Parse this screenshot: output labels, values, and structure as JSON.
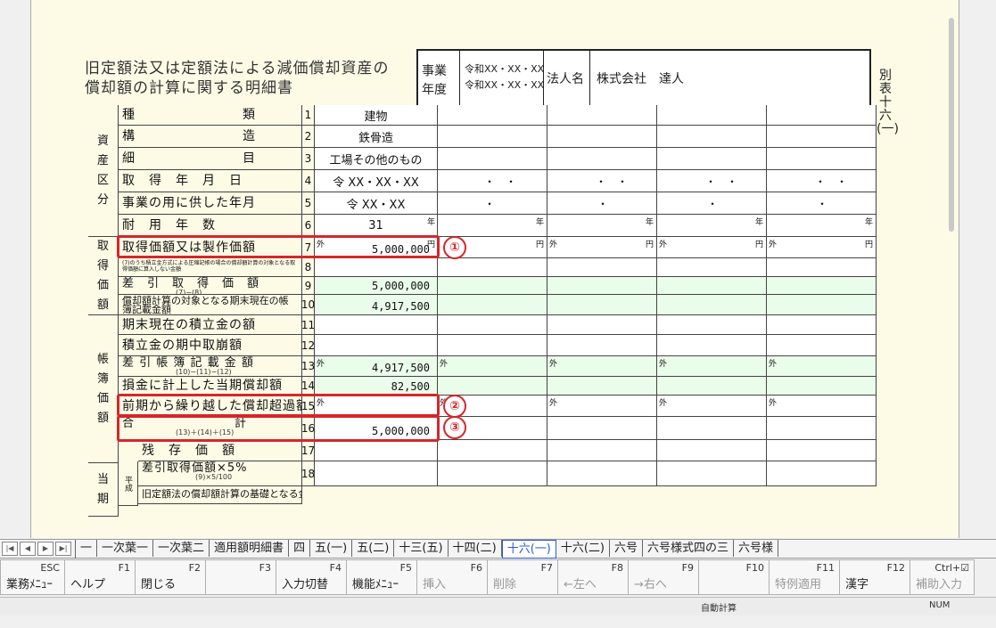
{
  "title": {
    "line1": "旧定額法又は定額法による減価償却資産の",
    "line2": "償却額の計算に関する明細書"
  },
  "header": {
    "jigyou": "事業",
    "nendo": "年度",
    "period_from": "令和XX・XX・XX",
    "period_to": "令和XX・XX・XX",
    "hojin_label": "法人名",
    "hojin_name": "株式会社　達人"
  },
  "side_note": "別表十六(一)",
  "sections": {
    "shisan": "資\n産\n区\n分",
    "shutoku": "取\n得\n価\n額",
    "chobo": "帳\n簿\n価\n額",
    "touki": "当\n期"
  },
  "rows": [
    {
      "no": "1",
      "label": "種　　　　　　　　類",
      "value": "建物"
    },
    {
      "no": "2",
      "label": "構　　　　　　　　造",
      "value": "鉄骨造"
    },
    {
      "no": "3",
      "label": "細　　　　　　　　目",
      "value": "工場その他のもの"
    },
    {
      "no": "4",
      "label": "取　得　年　月　日",
      "value": "令 XX・XX・XX"
    },
    {
      "no": "5",
      "label": "事業の用に供した年月",
      "value": "令 XX・XX"
    },
    {
      "no": "6",
      "label": "耐　用　年　数",
      "value": "31",
      "unit": "年"
    },
    {
      "no": "7",
      "label": "取得価額又は製作価額",
      "value": "5,000,000",
      "prefix": "外",
      "unit": "円"
    },
    {
      "no": "8",
      "label": "(7)のうち積立金方式による圧縮記帳の場合の償却額計算の対象となる取得価額に算入しない金額",
      "value": ""
    },
    {
      "no": "9",
      "label": "差　引　取　得　価　額",
      "sub": "(7)−(8)",
      "value": "5,000,000"
    },
    {
      "no": "10",
      "label": "償却額計算の対象となる期末現在の帳簿記載金額",
      "value": "4,917,500"
    },
    {
      "no": "11",
      "label": "期末現在の積立金の額",
      "value": ""
    },
    {
      "no": "12",
      "label": "積立金の期中取崩額",
      "value": ""
    },
    {
      "no": "13",
      "label": "差 引 帳 簿 記 載 金 額",
      "sub": "(10)−(11)−(12)",
      "value": "4,917,500",
      "prefix": "外"
    },
    {
      "no": "14",
      "label": "損金に計上した当期償却額",
      "value": "82,500"
    },
    {
      "no": "15",
      "label": "前期から繰り越した償却超過額",
      "value": "",
      "prefix": "外"
    },
    {
      "no": "16",
      "label": "合　　　　　　　　計",
      "sub": "(13)＋(14)＋(15)",
      "value": "5,000,000"
    },
    {
      "no": "17",
      "label": "残　存　価　額",
      "value": ""
    },
    {
      "no": "18",
      "label": "差引取得価額×5%",
      "sub": "(9)×5/100",
      "value": ""
    }
  ],
  "row19_label": "旧定額法の償却額計算の基礎となる金額",
  "heisei": "平成",
  "dots_date": "・　・",
  "dot": "・",
  "yen": "円",
  "nen": "年",
  "soto": "外",
  "badges": [
    "①",
    "②",
    "③"
  ],
  "tabs": [
    "一",
    "一次葉一",
    "一次葉二",
    "適用額明細書",
    "四",
    "五(一)",
    "五(二)",
    "十三(五)",
    "十四(二)",
    "十六(一)",
    "十六(二)",
    "六号",
    "六号様式四の三",
    "六号様"
  ],
  "active_tab": "十六(一)",
  "fkeys": [
    {
      "key": "ESC",
      "label": "業務ﾒﾆｭｰ"
    },
    {
      "key": "F1",
      "label": "ヘルプ"
    },
    {
      "key": "F2",
      "label": "閉じる"
    },
    {
      "key": "F3",
      "label": ""
    },
    {
      "key": "F4",
      "label": "入力切替"
    },
    {
      "key": "F5",
      "label": "機能ﾒﾆｭｰ"
    },
    {
      "key": "F6",
      "label": "挿入"
    },
    {
      "key": "F7",
      "label": "削除"
    },
    {
      "key": "F8",
      "label": "←左へ"
    },
    {
      "key": "F9",
      "label": "→右へ"
    },
    {
      "key": "F10",
      "label": ""
    },
    {
      "key": "F11",
      "label": "特例適用"
    },
    {
      "key": "F12",
      "label": "漢字"
    },
    {
      "key": "Ctrl+☑",
      "label": "補助入力"
    }
  ],
  "status": {
    "auto_calc": "自動計算",
    "num": "NUM"
  },
  "colors": {
    "highlight": "#d6262a",
    "active_tab": "#2d5bd6",
    "form_bg": "#fdfbe6",
    "readonly_bg": "#eafcea"
  }
}
